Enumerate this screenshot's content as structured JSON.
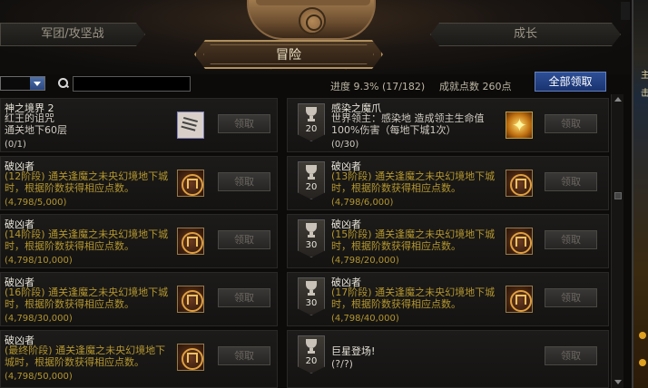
{
  "tabs": {
    "left": "军团/攻坚战",
    "active": "冒险",
    "right": "成长"
  },
  "filter": {
    "dropdown_value": "",
    "search_placeholder": ""
  },
  "summary": {
    "progress": "进度  9.3% (17/182)",
    "points": "成就点数 260点",
    "claim_all": "全部领取"
  },
  "claim_label": "领取",
  "left_cards": [
    {
      "title": "神之境界 2",
      "desc": "红王的诅咒\n通关地下60层",
      "progress": "(0/1)",
      "icon": "paper-scroll-icon"
    },
    {
      "title": "破凶者",
      "desc_pl": "(12阶段)",
      "desc": " 通关逢魔之未央幻境地下城时，根据阶数获得相应点数。",
      "progress": "(4,798/5,000)",
      "icon": "emblem-icon"
    },
    {
      "title": "破凶者",
      "desc_pl": "(14阶段)",
      "desc": " 通关逢魔之未央幻境地下城时，根据阶数获得相应点数。",
      "progress": "(4,798/10,000)",
      "icon": "emblem-icon"
    },
    {
      "title": "破凶者",
      "desc_pl": "(16阶段)",
      "desc": " 通关逢魔之未央幻境地下城时，根据阶数获得相应点数。",
      "progress": "(4,798/30,000)",
      "icon": "emblem-icon"
    },
    {
      "title": "破凶者",
      "desc_pl": "(最终阶段)",
      "desc": " 通关逢魔之未央幻境地下城时，根据阶数获得相应点数。",
      "progress": "(4,798/50,000)",
      "icon": "emblem-icon"
    }
  ],
  "right_cards": [
    {
      "points": "20",
      "title": "感染之魔爪",
      "desc": "世界领主：感染地          造成领主生命值100%伤害（每地下城1次）",
      "progress": "(0/30)",
      "icon": "star-burst-icon"
    },
    {
      "points": "20",
      "title": "破凶者",
      "desc_pl": "(13阶段)",
      "desc": " 通关逢魔之未央幻境地下城时，根据阶数获得相应点数。",
      "progress": "(4,798/6,000)",
      "icon": "emblem-icon"
    },
    {
      "points": "30",
      "title": "破凶者",
      "desc_pl": "(15阶段)",
      "desc": " 通关逢魔之未央幻境地下城时，根据阶数获得相应点数。",
      "progress": "(4,798/20,000)",
      "icon": "emblem-icon"
    },
    {
      "points": "30",
      "title": "破凶者",
      "desc_pl": "(17阶段)",
      "desc": " 通关逢魔之未央幻境地下城时，根据阶数获得相应点数。",
      "progress": "(4,798/40,000)",
      "icon": "emblem-icon"
    },
    {
      "points": "20",
      "title": "巨星登场!",
      "desc": "(?/?)",
      "progress": "",
      "icon": ""
    }
  ],
  "edge": {
    "right_strip_top": "主",
    "right_strip_mid": "击"
  },
  "colors": {
    "accent_gold": "#b4962e",
    "claim_all_blue": "#2e4f96",
    "title_text": "#e8e4d8"
  }
}
